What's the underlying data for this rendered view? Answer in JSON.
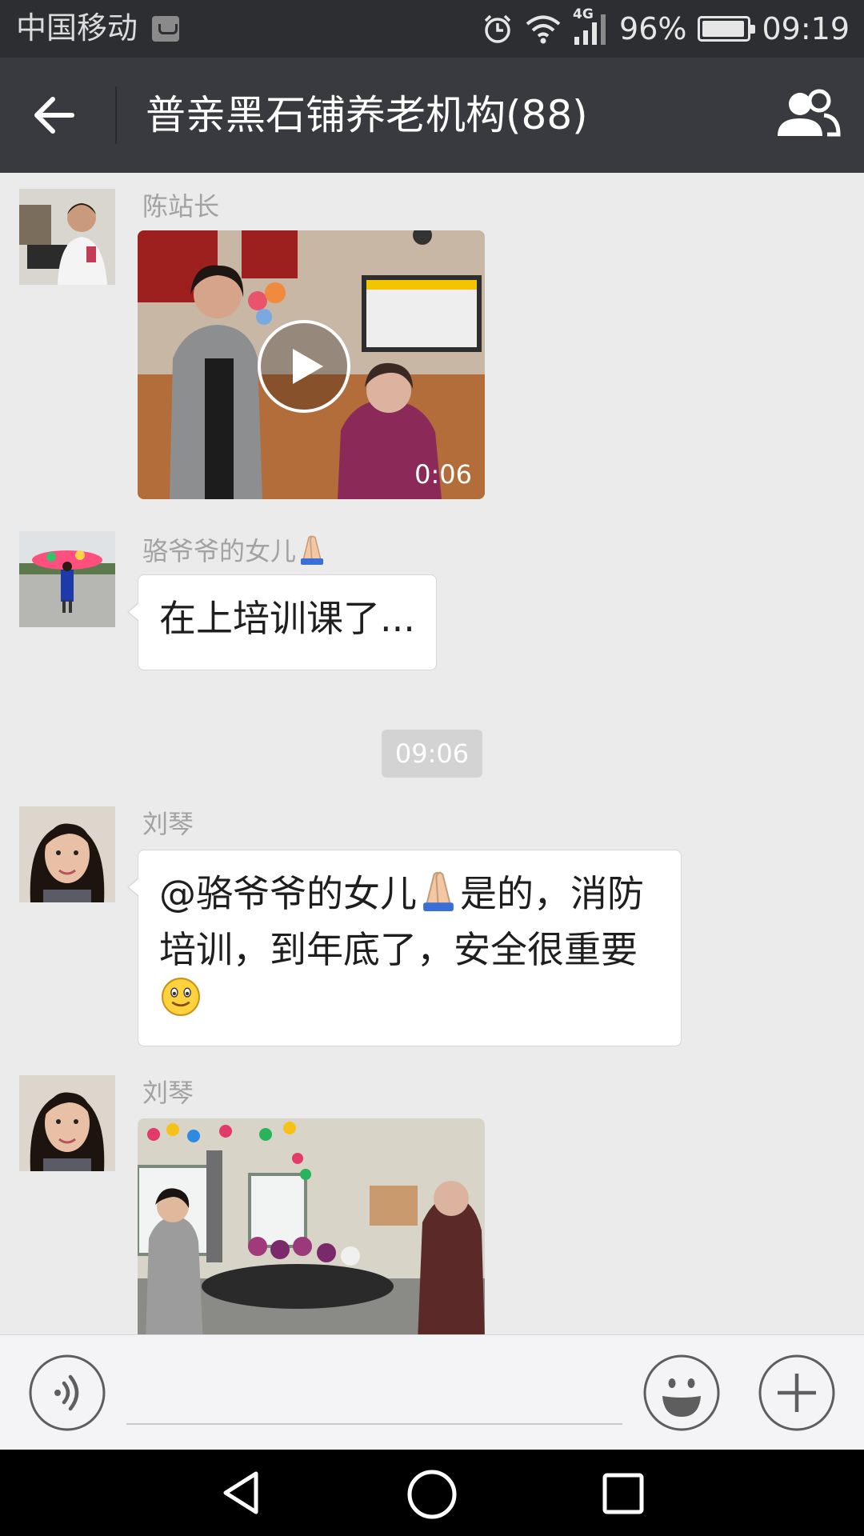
{
  "status_bar": {
    "carrier": "中国移动",
    "network": "4G",
    "battery_percent": "96%",
    "battery_level": 0.96,
    "time": "09:19",
    "icons": [
      "message-notification-icon",
      "alarm-icon",
      "wifi-icon",
      "signal-icon",
      "battery-icon"
    ]
  },
  "header": {
    "title": "普亲黑石铺养老机构(88)",
    "back_icon": "arrow-left-icon",
    "members_icon": "group-members-icon"
  },
  "messages": [
    {
      "sender": "陈站长",
      "type": "video",
      "duration": "0:06"
    },
    {
      "sender": "骆爷爷的女儿",
      "sender_emoji": "folded-hands",
      "type": "text",
      "text": "在上培训课了..."
    },
    {
      "type": "timestamp",
      "text": "09:06"
    },
    {
      "sender": "刘琴",
      "type": "text",
      "text_parts": [
        "@骆爷爷的女儿",
        "是的，消防培训，到年底了，安全很重要"
      ],
      "emojis": [
        "folded-hands",
        "smiling-face"
      ]
    },
    {
      "sender": "刘琴",
      "type": "image"
    }
  ],
  "input_bar": {
    "placeholder": "",
    "voice_icon": "voice-icon",
    "emoji_icon": "emoji-icon",
    "plus_icon": "plus-icon"
  },
  "nav_bar": {
    "icons": [
      "nav-back-icon",
      "nav-home-icon",
      "nav-recent-icon"
    ]
  },
  "colors": {
    "status_bar_bg": "#2d2e31",
    "header_bg": "#393a3f",
    "chat_bg": "#ebebeb",
    "bubble_bg": "#ffffff",
    "timestamp_bg": "#d3d3d3",
    "input_bar_bg": "#f4f4f6"
  }
}
